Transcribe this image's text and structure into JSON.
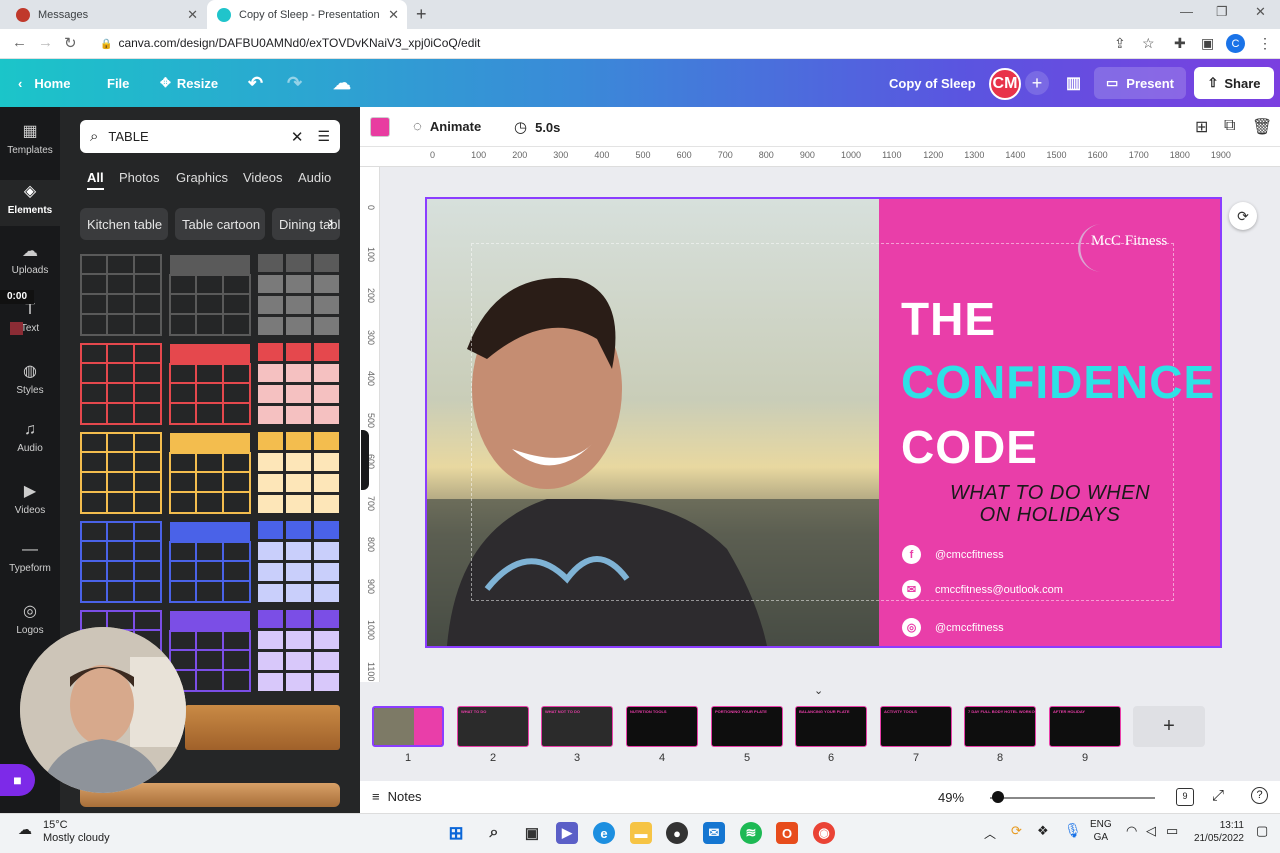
{
  "browser": {
    "tabs": [
      {
        "title": "Messages"
      },
      {
        "title": "Copy of Sleep - Presentation"
      }
    ],
    "url": "canva.com/design/DAFBU0AMNd0/exTOVDvKNaiV3_xpj0iCoQ/edit",
    "profile_initial": "C"
  },
  "topbar": {
    "home": "Home",
    "file": "File",
    "resize": "Resize",
    "doc_title": "Copy of Sleep",
    "avatar": "CM",
    "present": "Present",
    "share": "Share"
  },
  "rail": {
    "items": [
      "Templates",
      "Elements",
      "Uploads",
      "Text",
      "Styles",
      "Audio",
      "Videos",
      "Typeform",
      "Logos"
    ],
    "timer": "0:00"
  },
  "panel": {
    "search_value": "TABLE",
    "tabs": [
      "All",
      "Photos",
      "Graphics",
      "Videos",
      "Audio"
    ],
    "chips": [
      "Kitchen table",
      "Table cartoon",
      "Dining table"
    ]
  },
  "toolbar": {
    "animate": "Animate",
    "duration": "5.0s",
    "color": "#e83ca0"
  },
  "ruler": {
    "h": [
      "0",
      "100",
      "200",
      "300",
      "400",
      "500",
      "600",
      "700",
      "800",
      "900",
      "1000",
      "1100",
      "1200",
      "1300",
      "1400",
      "1500",
      "1600",
      "1700",
      "1800",
      "1900"
    ],
    "v": [
      "0",
      "100",
      "200",
      "300",
      "400",
      "500",
      "600",
      "700",
      "800",
      "900",
      "1000",
      "1100"
    ]
  },
  "slide": {
    "logo": "McC Fitness",
    "title_line1": "THE",
    "title_line2": "CONFIDENCE",
    "title_line3": "CODE",
    "subtitle_line1": "WHAT TO DO WHEN",
    "subtitle_line2": "ON HOLIDAYS",
    "contacts": [
      {
        "icon": "facebook-icon",
        "text": "@cmccfitness"
      },
      {
        "icon": "email-icon",
        "text": "cmccfitness@outlook.com"
      },
      {
        "icon": "instagram-icon",
        "text": "@cmccfitness"
      }
    ],
    "accent": "#e93ea9",
    "highlight": "#2de2e6"
  },
  "pages": {
    "numbers": [
      "1",
      "2",
      "3",
      "4",
      "5",
      "6",
      "7",
      "8",
      "9"
    ],
    "thumb_titles": [
      "",
      "WHAT TO DO",
      "WHAT NOT TO DO",
      "NUTRITION TOOLS",
      "PORTIONING YOUR PLATE",
      "BALANCING YOUR PLATE",
      "ACTIVITY TOOLS",
      "7 DAY FULL BODY HOTEL WORKOUT",
      "AFTER HOLIDAY"
    ]
  },
  "bottom": {
    "notes": "Notes",
    "zoom": "49%",
    "zoom_level": 0.05,
    "page_count": "9"
  },
  "taskbar": {
    "temp": "15°C",
    "weather": "Mostly cloudy",
    "lang1": "ENG",
    "lang2": "GA",
    "time": "13:11",
    "date": "21/05/2022"
  }
}
